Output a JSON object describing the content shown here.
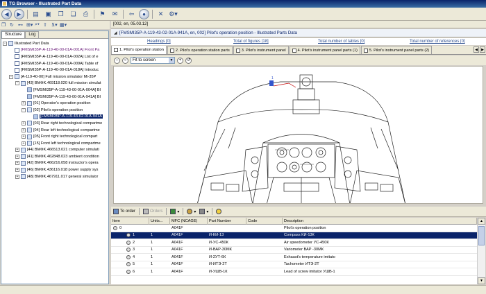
{
  "window": {
    "title": "TG Browser - Illustrated Part Data"
  },
  "left_tabs": [
    "Structure",
    "Log"
  ],
  "tree": [
    {
      "indent": 0,
      "exp": "-",
      "icon": "folder",
      "label": "Illustrated Part Data",
      "link": false
    },
    {
      "indent": 1,
      "exp": "",
      "icon": "doc",
      "label": "[FMSMI35P-A-119-40-00-01A-001A] Front Pa",
      "link": true
    },
    {
      "indent": 1,
      "exp": "",
      "icon": "doc",
      "label": "[FMSMI35P-A-119-40-00-01A-002A] List of e",
      "link": false
    },
    {
      "indent": 1,
      "exp": "",
      "icon": "doc",
      "label": "[FMSMI35P-A-119-40-00-01A-009A] Table of",
      "link": false
    },
    {
      "indent": 1,
      "exp": "",
      "icon": "doc",
      "label": "[FMSMI35P-A-119-40-00-01A-018A] Introduc",
      "link": false
    },
    {
      "indent": 1,
      "exp": "-",
      "icon": "folder",
      "label": "[A-119-40-00] Full mission simulator Mi-35P",
      "link": false
    },
    {
      "indent": 2,
      "exp": "-",
      "icon": "folder",
      "label": "[43] BMФK.469118.020 full mission simulat",
      "link": false
    },
    {
      "indent": 3,
      "exp": "",
      "icon": "fig",
      "label": "[FMSMI35P-A-119-43-00-01A-004A] Bl",
      "link": false
    },
    {
      "indent": 3,
      "exp": "",
      "icon": "fig",
      "label": "[FMSMI35P-A-119-43-00-01A-941A] Bl",
      "link": false
    },
    {
      "indent": 3,
      "exp": "+",
      "icon": "folder",
      "label": "[01] Operator's operation position",
      "link": false
    },
    {
      "indent": 3,
      "exp": "-",
      "icon": "folder",
      "label": "[02] Pilot's operation position",
      "link": false
    },
    {
      "indent": 4,
      "exp": "",
      "icon": "fig",
      "label": "[FMSMI35P-A-119-43-02-01A-941A",
      "link": false,
      "selected": true
    },
    {
      "indent": 3,
      "exp": "+",
      "icon": "folder",
      "label": "[03] Rear right technological compartme",
      "link": false
    },
    {
      "indent": 3,
      "exp": "+",
      "icon": "folder",
      "label": "[04] Rear left technological compartme",
      "link": false
    },
    {
      "indent": 3,
      "exp": "+",
      "icon": "folder",
      "label": "[05] Front right technological compart",
      "link": false
    },
    {
      "indent": 3,
      "exp": "+",
      "icon": "folder",
      "label": "[15] Front left technological compartme",
      "link": false
    },
    {
      "indent": 2,
      "exp": "+",
      "icon": "folder",
      "label": "[44] BMФK.466513.021 computer simulati",
      "link": false
    },
    {
      "indent": 2,
      "exp": "+",
      "icon": "folder",
      "label": "[41] BMФK.462848.023 ambient condition",
      "link": false
    },
    {
      "indent": 2,
      "exp": "+",
      "icon": "folder",
      "label": "[42] BMФK.466216.058 instructor's opera",
      "link": false
    },
    {
      "indent": 2,
      "exp": "+",
      "icon": "folder",
      "label": "[46] BMФK.436116.018 power supply sys",
      "link": false
    },
    {
      "indent": 2,
      "exp": "+",
      "icon": "folder",
      "label": "[48] BMФK.467911.017 general simulator",
      "link": false
    }
  ],
  "doc_header": "[002, en, 05.03.12]",
  "doc_title": "[FMSMI35P-A-119-43-02-01A-941A, en, 002] Pilot's operation position - Illustrated Parts Data",
  "summary": {
    "headings": "Headings [0]",
    "figures": "Total of figures [18]",
    "tables": "Total number of tables [0]",
    "references": "Total number of references [0]"
  },
  "fig_tabs": [
    "1. Pilot's operation station",
    "2. Pilot's operation station parts",
    "3. Pilot's instrument panel",
    "4. Pilot's instrument panel parts (1)",
    "5. Pilot's instrument panel parts (2)"
  ],
  "zoom": "Fit to screen",
  "figure_callout": "1",
  "parts_toolbar": {
    "to_order": "To order",
    "orders": "Orders"
  },
  "parts_columns": [
    "Item",
    "Units...",
    "MFC (NCAGE)",
    "Part Number",
    "Code",
    "Description"
  ],
  "parts_rows": [
    {
      "item": "0",
      "units": "",
      "mfc": "A041F",
      "pn": "",
      "code": "",
      "desc": "Pilot's operation position",
      "level": 0
    },
    {
      "item": "1",
      "units": "1",
      "mfc": "A041F",
      "pn": "И-КИ-13",
      "code": "",
      "desc": "Compass КИ-13К",
      "level": 1,
      "selected": true
    },
    {
      "item": "2",
      "units": "1",
      "mfc": "A041F",
      "pn": "И-УС-450К",
      "code": "",
      "desc": "Air speedometer  УС-450К",
      "level": 1
    },
    {
      "item": "3",
      "units": "1",
      "mfc": "A041F",
      "pn": "И-ВАР-30МК",
      "code": "",
      "desc": "Variometer ВАР -30МК",
      "level": 1
    },
    {
      "item": "4",
      "units": "1",
      "mfc": "A041F",
      "pn": "И-2УТ-6К",
      "code": "",
      "desc": "Exhaust's temperature imitato",
      "level": 1
    },
    {
      "item": "5",
      "units": "1",
      "mfc": "A041F",
      "pn": "И-ИТЭ-2Т",
      "code": "",
      "desc": "Tachometer ИТЭ-2Т",
      "level": 1
    },
    {
      "item": "6",
      "units": "1",
      "mfc": "A041F",
      "pn": "И-УШВ-1К",
      "code": "",
      "desc": "Lead of screw imitator УШВ-1",
      "level": 1
    }
  ],
  "colors": {
    "selection": "#0a246a",
    "link": "#2a4d8f",
    "visited_link": "#6a1a7a",
    "title_gradient_start": "#0a246a"
  }
}
